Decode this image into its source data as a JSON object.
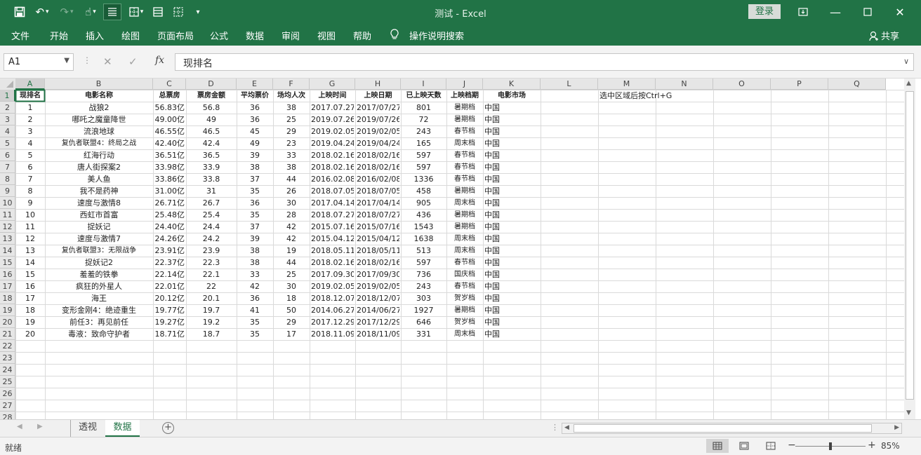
{
  "window": {
    "title": "测试  -  Excel",
    "login_label": "登录"
  },
  "ribbon": {
    "tabs": [
      "文件",
      "开始",
      "插入",
      "绘图",
      "页面布局",
      "公式",
      "数据",
      "审阅",
      "视图",
      "帮助"
    ],
    "tell_me": "操作说明搜索",
    "share": "共享"
  },
  "formula_bar": {
    "name_box": "A1",
    "formula": "现排名"
  },
  "columns": [
    "A",
    "B",
    "C",
    "D",
    "E",
    "F",
    "G",
    "H",
    "I",
    "J",
    "K",
    "L",
    "M",
    "N",
    "O",
    "P",
    "Q"
  ],
  "rows": [
    "1",
    "2",
    "3",
    "4",
    "5",
    "6",
    "7",
    "8",
    "9",
    "10",
    "11",
    "12",
    "13",
    "14",
    "15",
    "16",
    "17",
    "18",
    "19",
    "20",
    "21",
    "22",
    "23",
    "24",
    "25",
    "26",
    "27",
    "28"
  ],
  "table": {
    "headers": [
      "现排名",
      "电影名称",
      "总票房",
      "票房金额",
      "平均票价",
      "场均人次",
      "上映时间",
      "上映日期",
      "已上映天数",
      "上映档期",
      "电影市场"
    ],
    "rows": [
      [
        "1",
        "战狼2",
        "56.83亿",
        "56.8",
        "36",
        "38",
        "2017.07.27",
        "2017/07/27",
        "801",
        "暑期档",
        "中国"
      ],
      [
        "2",
        "哪吒之魔童降世",
        "49.00亿",
        "49",
        "36",
        "25",
        "2019.07.26",
        "2019/07/26",
        "72",
        "暑期档",
        "中国"
      ],
      [
        "3",
        "流浪地球",
        "46.55亿",
        "46.5",
        "45",
        "29",
        "2019.02.05",
        "2019/02/05",
        "243",
        "春节档",
        "中国"
      ],
      [
        "4",
        "复仇者联盟4：终局之战",
        "42.40亿",
        "42.4",
        "49",
        "23",
        "2019.04.24",
        "2019/04/24",
        "165",
        "周末档",
        "中国"
      ],
      [
        "5",
        "红海行动",
        "36.51亿",
        "36.5",
        "39",
        "33",
        "2018.02.16",
        "2018/02/16",
        "597",
        "春节档",
        "中国"
      ],
      [
        "6",
        "唐人街探案2",
        "33.98亿",
        "33.9",
        "38",
        "38",
        "2018.02.16",
        "2018/02/16",
        "597",
        "春节档",
        "中国"
      ],
      [
        "7",
        "美人鱼",
        "33.86亿",
        "33.8",
        "37",
        "44",
        "2016.02.08",
        "2016/02/08",
        "1336",
        "春节档",
        "中国"
      ],
      [
        "8",
        "我不是药神",
        "31.00亿",
        "31",
        "35",
        "26",
        "2018.07.05",
        "2018/07/05",
        "458",
        "暑期档",
        "中国"
      ],
      [
        "9",
        "速度与激情8",
        "26.71亿",
        "26.7",
        "36",
        "30",
        "2017.04.14",
        "2017/04/14",
        "905",
        "周末档",
        "中国"
      ],
      [
        "10",
        "西虹市首富",
        "25.48亿",
        "25.4",
        "35",
        "28",
        "2018.07.27",
        "2018/07/27",
        "436",
        "暑期档",
        "中国"
      ],
      [
        "11",
        "捉妖记",
        "24.40亿",
        "24.4",
        "37",
        "42",
        "2015.07.16",
        "2015/07/16",
        "1543",
        "暑期档",
        "中国"
      ],
      [
        "12",
        "速度与激情7",
        "24.26亿",
        "24.2",
        "39",
        "42",
        "2015.04.12",
        "2015/04/12",
        "1638",
        "周末档",
        "中国"
      ],
      [
        "13",
        "复仇者联盟3：无限战争",
        "23.91亿",
        "23.9",
        "38",
        "19",
        "2018.05.11",
        "2018/05/11",
        "513",
        "周末档",
        "中国"
      ],
      [
        "14",
        "捉妖记2",
        "22.37亿",
        "22.3",
        "38",
        "44",
        "2018.02.16",
        "2018/02/16",
        "597",
        "春节档",
        "中国"
      ],
      [
        "15",
        "羞羞的铁拳",
        "22.14亿",
        "22.1",
        "33",
        "25",
        "2017.09.30",
        "2017/09/30",
        "736",
        "国庆档",
        "中国"
      ],
      [
        "16",
        "疯狂的外星人",
        "22.01亿",
        "22",
        "42",
        "30",
        "2019.02.05",
        "2019/02/05",
        "243",
        "春节档",
        "中国"
      ],
      [
        "17",
        "海王",
        "20.12亿",
        "20.1",
        "36",
        "18",
        "2018.12.07",
        "2018/12/07",
        "303",
        "贺岁档",
        "中国"
      ],
      [
        "18",
        "变形金刚4：绝迹重生",
        "19.77亿",
        "19.7",
        "41",
        "50",
        "2014.06.27",
        "2014/06/27",
        "1927",
        "暑期档",
        "中国"
      ],
      [
        "19",
        "前任3：再见前任",
        "19.27亿",
        "19.2",
        "35",
        "29",
        "2017.12.29",
        "2017/12/29",
        "646",
        "贺岁档",
        "中国"
      ],
      [
        "20",
        "毒液：致命守护者",
        "18.71亿",
        "18.7",
        "35",
        "17",
        "2018.11.09",
        "2018/11/09",
        "331",
        "周末档",
        "中国"
      ]
    ]
  },
  "note_cell": {
    "ref": "M1",
    "text": "选中区域后按Ctrl+G"
  },
  "sheets": [
    {
      "name": "透视",
      "active": false
    },
    {
      "name": "数据",
      "active": true
    }
  ],
  "status": {
    "ready": "就绪",
    "zoom": "85%",
    "zoom_fraction": 0.5
  },
  "colors": {
    "accent": "#217346",
    "header_bg": "#e6e6e6",
    "gridline": "#dadada"
  }
}
